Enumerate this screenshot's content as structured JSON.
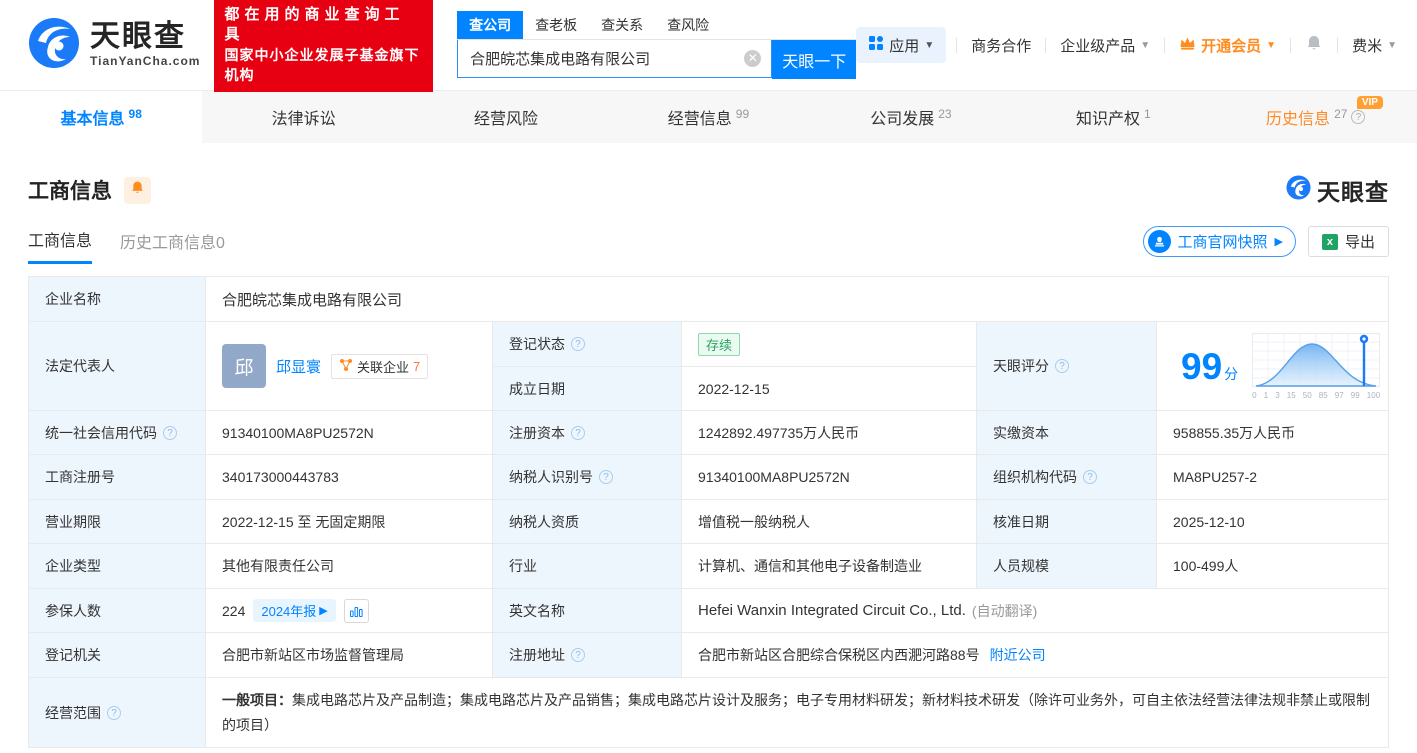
{
  "header": {
    "logo": {
      "title": "天眼查",
      "subtitle": "TianYanCha.com"
    },
    "promo": {
      "line1": "都在用的商业查询工具",
      "line2": "国家中小企业发展子基金旗下机构"
    },
    "search": {
      "tabs": [
        {
          "label": "查公司"
        },
        {
          "label": "查老板"
        },
        {
          "label": "查关系"
        },
        {
          "label": "查风险"
        }
      ],
      "value": "合肥皖芯集成电路有限公司",
      "button": "天眼一下"
    },
    "nav": {
      "app": "应用",
      "business": "商务合作",
      "enterprise": "企业级产品",
      "vip": "开通会员",
      "user": "费米"
    }
  },
  "tabs": [
    {
      "label": "基本信息",
      "count": "98"
    },
    {
      "label": "法律诉讼",
      "count": ""
    },
    {
      "label": "经营风险",
      "count": ""
    },
    {
      "label": "经营信息",
      "count": "99"
    },
    {
      "label": "公司发展",
      "count": "23"
    },
    {
      "label": "知识产权",
      "count": "1"
    },
    {
      "label": "历史信息",
      "count": "27",
      "vip": "VIP"
    }
  ],
  "section": {
    "title": "工商信息",
    "subtabs": [
      {
        "label": "工商信息"
      },
      {
        "label": "历史工商信息0"
      }
    ],
    "snapshot_button": "工商官网快照",
    "export_button": "导出",
    "watermark": "天眼查"
  },
  "table": {
    "company_name_label": "企业名称",
    "company_name": "合肥皖芯集成电路有限公司",
    "legal_rep_label": "法定代表人",
    "legal_rep": {
      "avatar_char": "邱",
      "name": "邱显寰",
      "related_label": "关联企业",
      "related_count": "7"
    },
    "reg_status_label": "登记状态",
    "reg_status": "存续",
    "establish_date_label": "成立日期",
    "establish_date": "2022-12-15",
    "score_label": "天眼评分",
    "score": {
      "value": "99",
      "unit": "分",
      "ticks": [
        "0",
        "1",
        "3",
        "15",
        "50",
        "85",
        "97",
        "99",
        "100"
      ]
    },
    "credit_code_label": "统一社会信用代码",
    "credit_code": "91340100MA8PU2572N",
    "reg_capital_label": "注册资本",
    "reg_capital": "1242892.497735万人民币",
    "paid_capital_label": "实缴资本",
    "paid_capital": "958855.35万人民币",
    "reg_number_label": "工商注册号",
    "reg_number": "340173000443783",
    "taxpayer_id_label": "纳税人识别号",
    "taxpayer_id": "91340100MA8PU2572N",
    "org_code_label": "组织机构代码",
    "org_code": "MA8PU257-2",
    "business_term_label": "营业期限",
    "business_term": "2022-12-15 至 无固定期限",
    "taxpayer_quality_label": "纳税人资质",
    "taxpayer_quality": "增值税一般纳税人",
    "approval_date_label": "核准日期",
    "approval_date": "2025-12-10",
    "company_type_label": "企业类型",
    "company_type": "其他有限责任公司",
    "industry_label": "行业",
    "industry": "计算机、通信和其他电子设备制造业",
    "staff_size_label": "人员规模",
    "staff_size": "100-499人",
    "insured_label": "参保人数",
    "insured": "224",
    "annual_report": "2024年报",
    "english_name_label": "英文名称",
    "english_name": "Hefei Wanxin Integrated Circuit Co., Ltd.",
    "english_name_note": "(自动翻译)",
    "reg_authority_label": "登记机关",
    "reg_authority": "合肥市新站区市场监督管理局",
    "reg_address_label": "注册地址",
    "reg_address": "合肥市新站区合肥综合保税区内西淝河路88号",
    "nearby_link": "附近公司",
    "business_scope_label": "经营范围",
    "business_scope_prefix": "一般项目：",
    "business_scope": "集成电路芯片及产品制造；集成电路芯片及产品销售；集成电路芯片设计及服务；电子专用材料研发；新材料技术研发（除许可业务外，可自主依法经营法律法规非禁止或限制的项目）"
  }
}
